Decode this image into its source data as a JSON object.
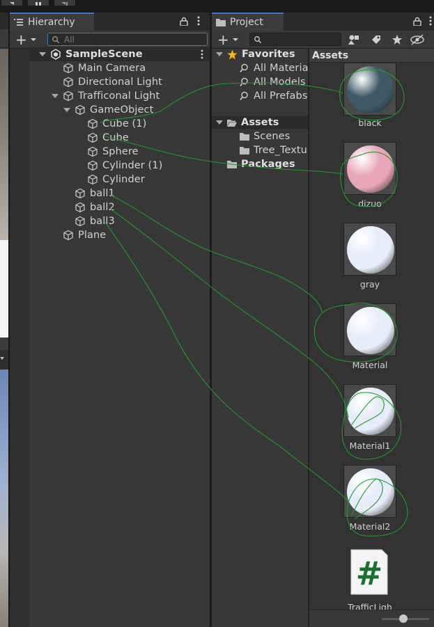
{
  "hierarchy": {
    "tab_label": "Hierarchy",
    "search_placeholder": "All",
    "add_label": "+",
    "items": [
      {
        "label": "SampleScene"
      },
      {
        "label": "Main Camera"
      },
      {
        "label": "Directional Light"
      },
      {
        "label": "Trafficonal Light"
      },
      {
        "label": "GameObject"
      },
      {
        "label": "Cube (1)"
      },
      {
        "label": "Cube"
      },
      {
        "label": "Sphere"
      },
      {
        "label": "Cylinder (1)"
      },
      {
        "label": "Cylinder"
      },
      {
        "label": "ball1"
      },
      {
        "label": "ball2"
      },
      {
        "label": "ball3"
      },
      {
        "label": "Plane"
      }
    ]
  },
  "project": {
    "tab_label": "Project",
    "add_label": "+",
    "tree": {
      "favorites_label": "Favorites",
      "favorites": [
        "All Materia",
        "All Models",
        "All Prefabs"
      ],
      "assets_label": "Assets",
      "asset_folders": [
        "Scenes",
        "Tree_Textu"
      ],
      "packages_label": "Packages"
    },
    "grid_header": "Assets",
    "assets": [
      {
        "label": "black",
        "color": "#3f5a66"
      },
      {
        "label": "dizuo",
        "color": "#e8a6b8"
      },
      {
        "label": "gray",
        "color": "#e6ecf8"
      },
      {
        "label": "Material",
        "color": "#e6ecf8"
      },
      {
        "label": "Material1",
        "color": "#e6ecf8"
      },
      {
        "label": "Material2",
        "color": "#e6ecf8"
      },
      {
        "label": "TrafficLigh",
        "icon": "csharp-script-icon"
      }
    ],
    "script_glyph": "#",
    "zoom_level": 0.5
  },
  "colors": {
    "accent": "#3d7bd6",
    "annotation": "#1f9a2a"
  }
}
